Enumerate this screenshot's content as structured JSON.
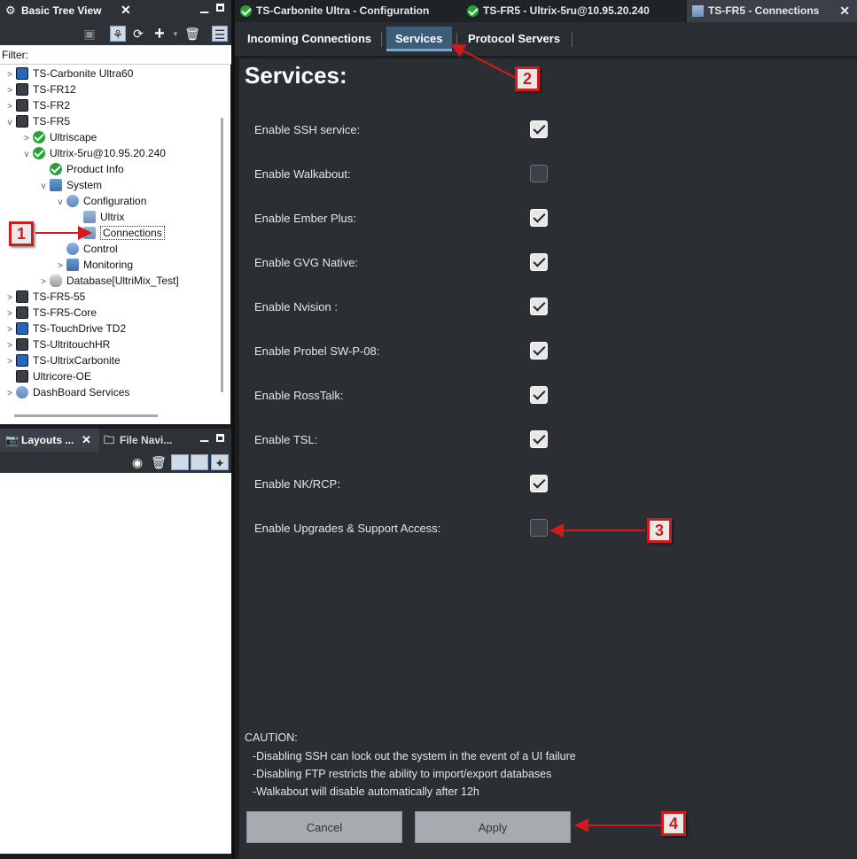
{
  "left_panel": {
    "title": "Basic Tree View",
    "filter_label": "Filter:",
    "filter_value": "",
    "tree": [
      {
        "label": "TS-Carbonite Ultra60",
        "icon": "carbonite-icon",
        "chevron": ">"
      },
      {
        "label": "TS-FR12",
        "icon": "frame-device-icon",
        "chevron": ">"
      },
      {
        "label": "TS-FR2",
        "icon": "frame-device-icon",
        "chevron": ">"
      },
      {
        "label": "TS-FR5",
        "icon": "frame-device-icon",
        "chevron": "v"
      },
      {
        "label": "Ultriscape",
        "icon": "status-ok-icon",
        "chevron": ">"
      },
      {
        "label": "Ultrix-5ru@10.95.20.240",
        "icon": "status-ok-icon",
        "chevron": "v"
      },
      {
        "label": "Product Info",
        "icon": "status-ok-icon",
        "chevron": ""
      },
      {
        "label": "System",
        "icon": "system-icon",
        "chevron": "v"
      },
      {
        "label": "Configuration",
        "icon": "configuration-icon",
        "chevron": "v"
      },
      {
        "label": "Ultrix",
        "icon": "node-icon",
        "chevron": ""
      },
      {
        "label": "Connections",
        "icon": "connections-icon",
        "chevron": ""
      },
      {
        "label": "Control",
        "icon": "control-icon",
        "chevron": ""
      },
      {
        "label": "Monitoring",
        "icon": "monitoring-icon",
        "chevron": ">"
      },
      {
        "label": "Database[UltriMix_Test]",
        "icon": "database-icon",
        "chevron": ">"
      },
      {
        "label": "TS-FR5-55",
        "icon": "frame-device-icon",
        "chevron": ">"
      },
      {
        "label": "TS-FR5-Core",
        "icon": "frame-device-icon",
        "chevron": ">"
      },
      {
        "label": "TS-TouchDrive TD2",
        "icon": "touchdrive-icon",
        "chevron": ">"
      },
      {
        "label": "TS-UltritouchHR",
        "icon": "frame-device-icon",
        "chevron": ">"
      },
      {
        "label": "TS-UltrixCarbonite",
        "icon": "carbonite-icon",
        "chevron": ">"
      },
      {
        "label": "Ultricore-OE",
        "icon": "frame-device-icon",
        "chevron": ""
      },
      {
        "label": "DashBoard Services",
        "icon": "dashboard-services-icon",
        "chevron": ">"
      }
    ],
    "bottom_tabs": [
      "Layouts ...",
      "File Navi..."
    ]
  },
  "editor_tabs": [
    {
      "label": "TS-Carbonite Ultra - Configuration",
      "icon": "status-ok-icon"
    },
    {
      "label": "TS-FR5 - Ultrix-5ru@10.95.20.240",
      "icon": "status-ok-icon"
    },
    {
      "label": "TS-FR5 - Connections",
      "icon": "connections-icon",
      "active": true
    }
  ],
  "sub_tabs": [
    {
      "label": "Incoming Connections",
      "active": false
    },
    {
      "label": "Services",
      "active": true
    },
    {
      "label": "Protocol Servers",
      "active": false
    }
  ],
  "services": {
    "heading": "Services:",
    "items": [
      {
        "label": "Enable SSH service:",
        "checked": true
      },
      {
        "label": "Enable Walkabout:",
        "checked": false
      },
      {
        "label": "Enable Ember Plus:",
        "checked": true
      },
      {
        "label": "Enable GVG Native:",
        "checked": true
      },
      {
        "label": "Enable Nvision :",
        "checked": true
      },
      {
        "label": "Enable Probel SW-P-08:",
        "checked": true
      },
      {
        "label": "Enable RossTalk:",
        "checked": true
      },
      {
        "label": "Enable TSL:",
        "checked": true
      },
      {
        "label": "Enable NK/RCP:",
        "checked": true
      },
      {
        "label": "Enable Upgrades & Support Access:",
        "checked": false
      }
    ],
    "caution": {
      "title": "CAUTION:",
      "lines": [
        "  -Disabling SSH can lock out the system in the event of a UI failure",
        "  -Disabling FTP restricts the ability to import/export databases",
        "  -Walkabout will disable automatically after 12h"
      ]
    },
    "cancel_label": "Cancel",
    "apply_label": "Apply"
  },
  "annotations": [
    "1",
    "2",
    "3",
    "4"
  ],
  "colors": {
    "annotation_red": "#d21a1a",
    "panel_dark": "#2b2e33",
    "active_subtab": "#3d5c7a",
    "status_ok_green": "#25a336"
  }
}
